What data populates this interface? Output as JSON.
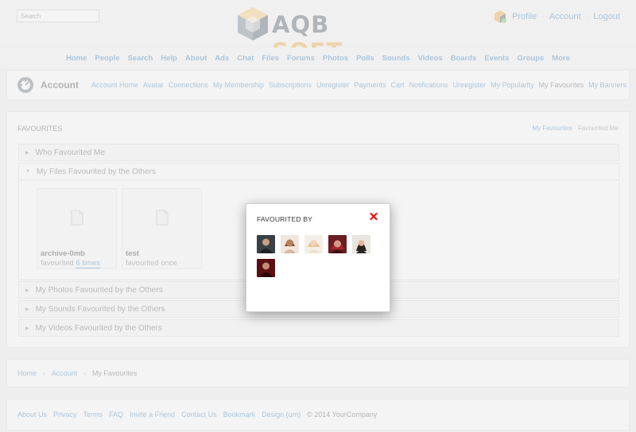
{
  "header": {
    "search_placeholder": "Search",
    "logo_part1": "AQB",
    "logo_part2": "SOFT",
    "user_links": [
      "Profile",
      "Account",
      "Logout"
    ]
  },
  "main_nav": [
    "Home",
    "People",
    "Search",
    "Help",
    "About",
    "Ads",
    "Chat",
    "Files",
    "Forums",
    "Photos",
    "Polls",
    "Sounds",
    "Videos",
    "Boards",
    "Events",
    "Groups",
    "More"
  ],
  "account_bar": {
    "title": "Account",
    "links": [
      "Account Home",
      "Avatar",
      "Connections",
      "My Membership",
      "Subscriptions",
      "Unregister",
      "Payments",
      "Cart",
      "Notifications",
      "Unregister",
      "My Popularity",
      "My Favourites",
      "My Banners"
    ],
    "active": "My Favourites"
  },
  "content": {
    "title": "Favourites",
    "tabs": {
      "active": "My Favourites",
      "inactive": "Favourited Me"
    },
    "sections": [
      {
        "label": "Who Favourited Me",
        "open": false
      },
      {
        "label": "My Files Favourited by the Others",
        "open": true
      },
      {
        "label": "My Photos Favourited by the Others",
        "open": false
      },
      {
        "label": "My Sounds Favourited by the Others",
        "open": false
      },
      {
        "label": "My Videos Favourited by the Others",
        "open": false
      }
    ],
    "files": [
      {
        "name": "archive-0mb",
        "fav_prefix": "favourited",
        "fav_count": "6 times"
      },
      {
        "name": "test",
        "fav_prefix": "favourited",
        "fav_count": "once"
      }
    ]
  },
  "breadcrumb": [
    "Home",
    "Account",
    "My Favourites"
  ],
  "footer": {
    "links": [
      "About Us",
      "Privacy",
      "Terms",
      "FAQ",
      "Invite a Friend",
      "Contact Us",
      "Bookmark",
      "Design (um)"
    ],
    "copyright": "© 2014 YourCompany"
  },
  "popup": {
    "title": "Favourited By",
    "avatars": [
      {
        "name": "avatar-man-dark",
        "bg": "#3b3f46",
        "fg": "#c9a07f"
      },
      {
        "name": "avatar-woman-light",
        "bg": "#f1e6dd",
        "fg": "#b7805e"
      },
      {
        "name": "avatar-woman-blonde",
        "bg": "#f4efe6",
        "fg": "#e2c58d"
      },
      {
        "name": "avatar-woman-red",
        "bg": "#6c1d22",
        "fg": "#d59a85"
      },
      {
        "name": "avatar-woman-dark-hair",
        "bg": "#e9e5df",
        "fg": "#2d211c"
      },
      {
        "name": "avatar-man-red",
        "bg": "#5a0f12",
        "fg": "#c48b72"
      }
    ]
  },
  "colors": {
    "link": "#3a86c5",
    "close": "#e00000",
    "logo_dark": "#4b5b66",
    "logo_orange": "#f2a93b"
  }
}
